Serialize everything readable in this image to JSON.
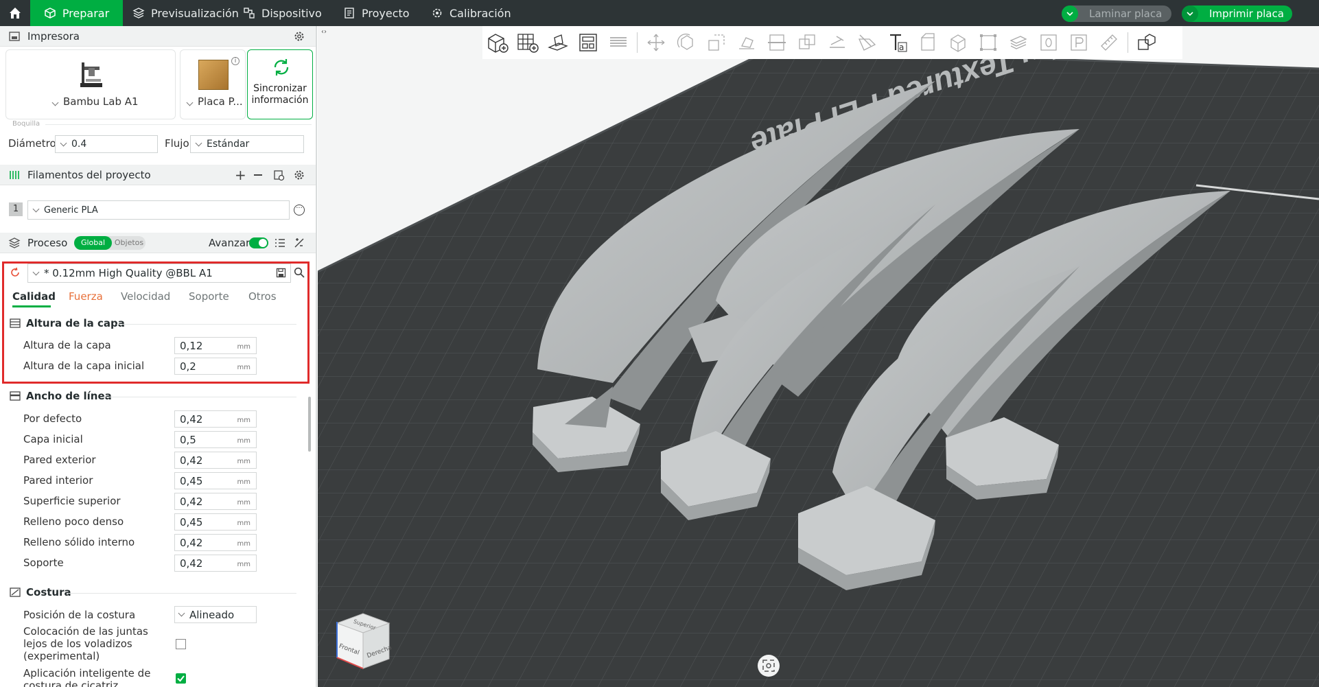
{
  "topbar": {
    "tabs": [
      {
        "label": "Preparar"
      },
      {
        "label": "Previsualización"
      },
      {
        "label": "Dispositivo"
      },
      {
        "label": "Proyecto"
      },
      {
        "label": "Calibración"
      }
    ],
    "slice_label": "Laminar placa",
    "print_label": "Imprimir placa"
  },
  "printer": {
    "section_title": "Impresora",
    "printer_name": "Bambu Lab A1",
    "plate_name": "Placa P...",
    "sync_label_1": "Sincronizar",
    "sync_label_2": "información",
    "nozzle_title": "Boquilla",
    "diameter_label": "Diámetro",
    "diameter_value": "0.4",
    "flow_label": "Flujo",
    "flow_value": "Estándar"
  },
  "filaments": {
    "section_title": "Filamentos del proyecto",
    "items": [
      {
        "index": "1",
        "name": "Generic PLA"
      }
    ]
  },
  "process": {
    "section_title": "Proceso",
    "toggle_global": "Global",
    "toggle_objects": "Objetos",
    "advanced_label": "Avanzar",
    "preset": "* 0.12mm High Quality @BBL A1",
    "tabs": [
      "Calidad",
      "Fuerza",
      "Velocidad",
      "Soporte",
      "Otros"
    ],
    "groups": {
      "layer_height": {
        "title": "Altura de la capa",
        "rows": [
          {
            "label": "Altura de la capa",
            "value": "0,12",
            "unit": "mm"
          },
          {
            "label": "Altura de la capa inicial",
            "value": "0,2",
            "unit": "mm"
          }
        ]
      },
      "line_width": {
        "title": "Ancho de línea",
        "rows": [
          {
            "label": "Por defecto",
            "value": "0,42",
            "unit": "mm"
          },
          {
            "label": "Capa inicial",
            "value": "0,5",
            "unit": "mm"
          },
          {
            "label": "Pared exterior",
            "value": "0,42",
            "unit": "mm"
          },
          {
            "label": "Pared interior",
            "value": "0,45",
            "unit": "mm"
          },
          {
            "label": "Superficie superior",
            "value": "0,42",
            "unit": "mm"
          },
          {
            "label": "Relleno poco denso",
            "value": "0,45",
            "unit": "mm"
          },
          {
            "label": "Relleno sólido interno",
            "value": "0,42",
            "unit": "mm"
          },
          {
            "label": "Soporte",
            "value": "0,42",
            "unit": "mm"
          }
        ]
      },
      "seam": {
        "title": "Costura",
        "position_label": "Posición de la costura",
        "position_value": "Alineado",
        "staggered_label": [
          "Colocación de las juntas",
          "lejos de los voladizos",
          "(experimental)"
        ],
        "staggered_checked": false,
        "smart_label": [
          "Aplicación inteligente de",
          "costura de cicatriz"
        ],
        "smart_checked": true
      }
    }
  },
  "viewport": {
    "plate_text": "Bambu Textured PEI Plate",
    "cube_faces": [
      "Superior",
      "Frontal",
      "Derecha"
    ]
  },
  "colors": {
    "accent": "#00ae42",
    "topbar": "#2d3436",
    "highlight_border": "#e02b2b",
    "plate": "#3a3d3e",
    "model": "#b9bcbd"
  }
}
